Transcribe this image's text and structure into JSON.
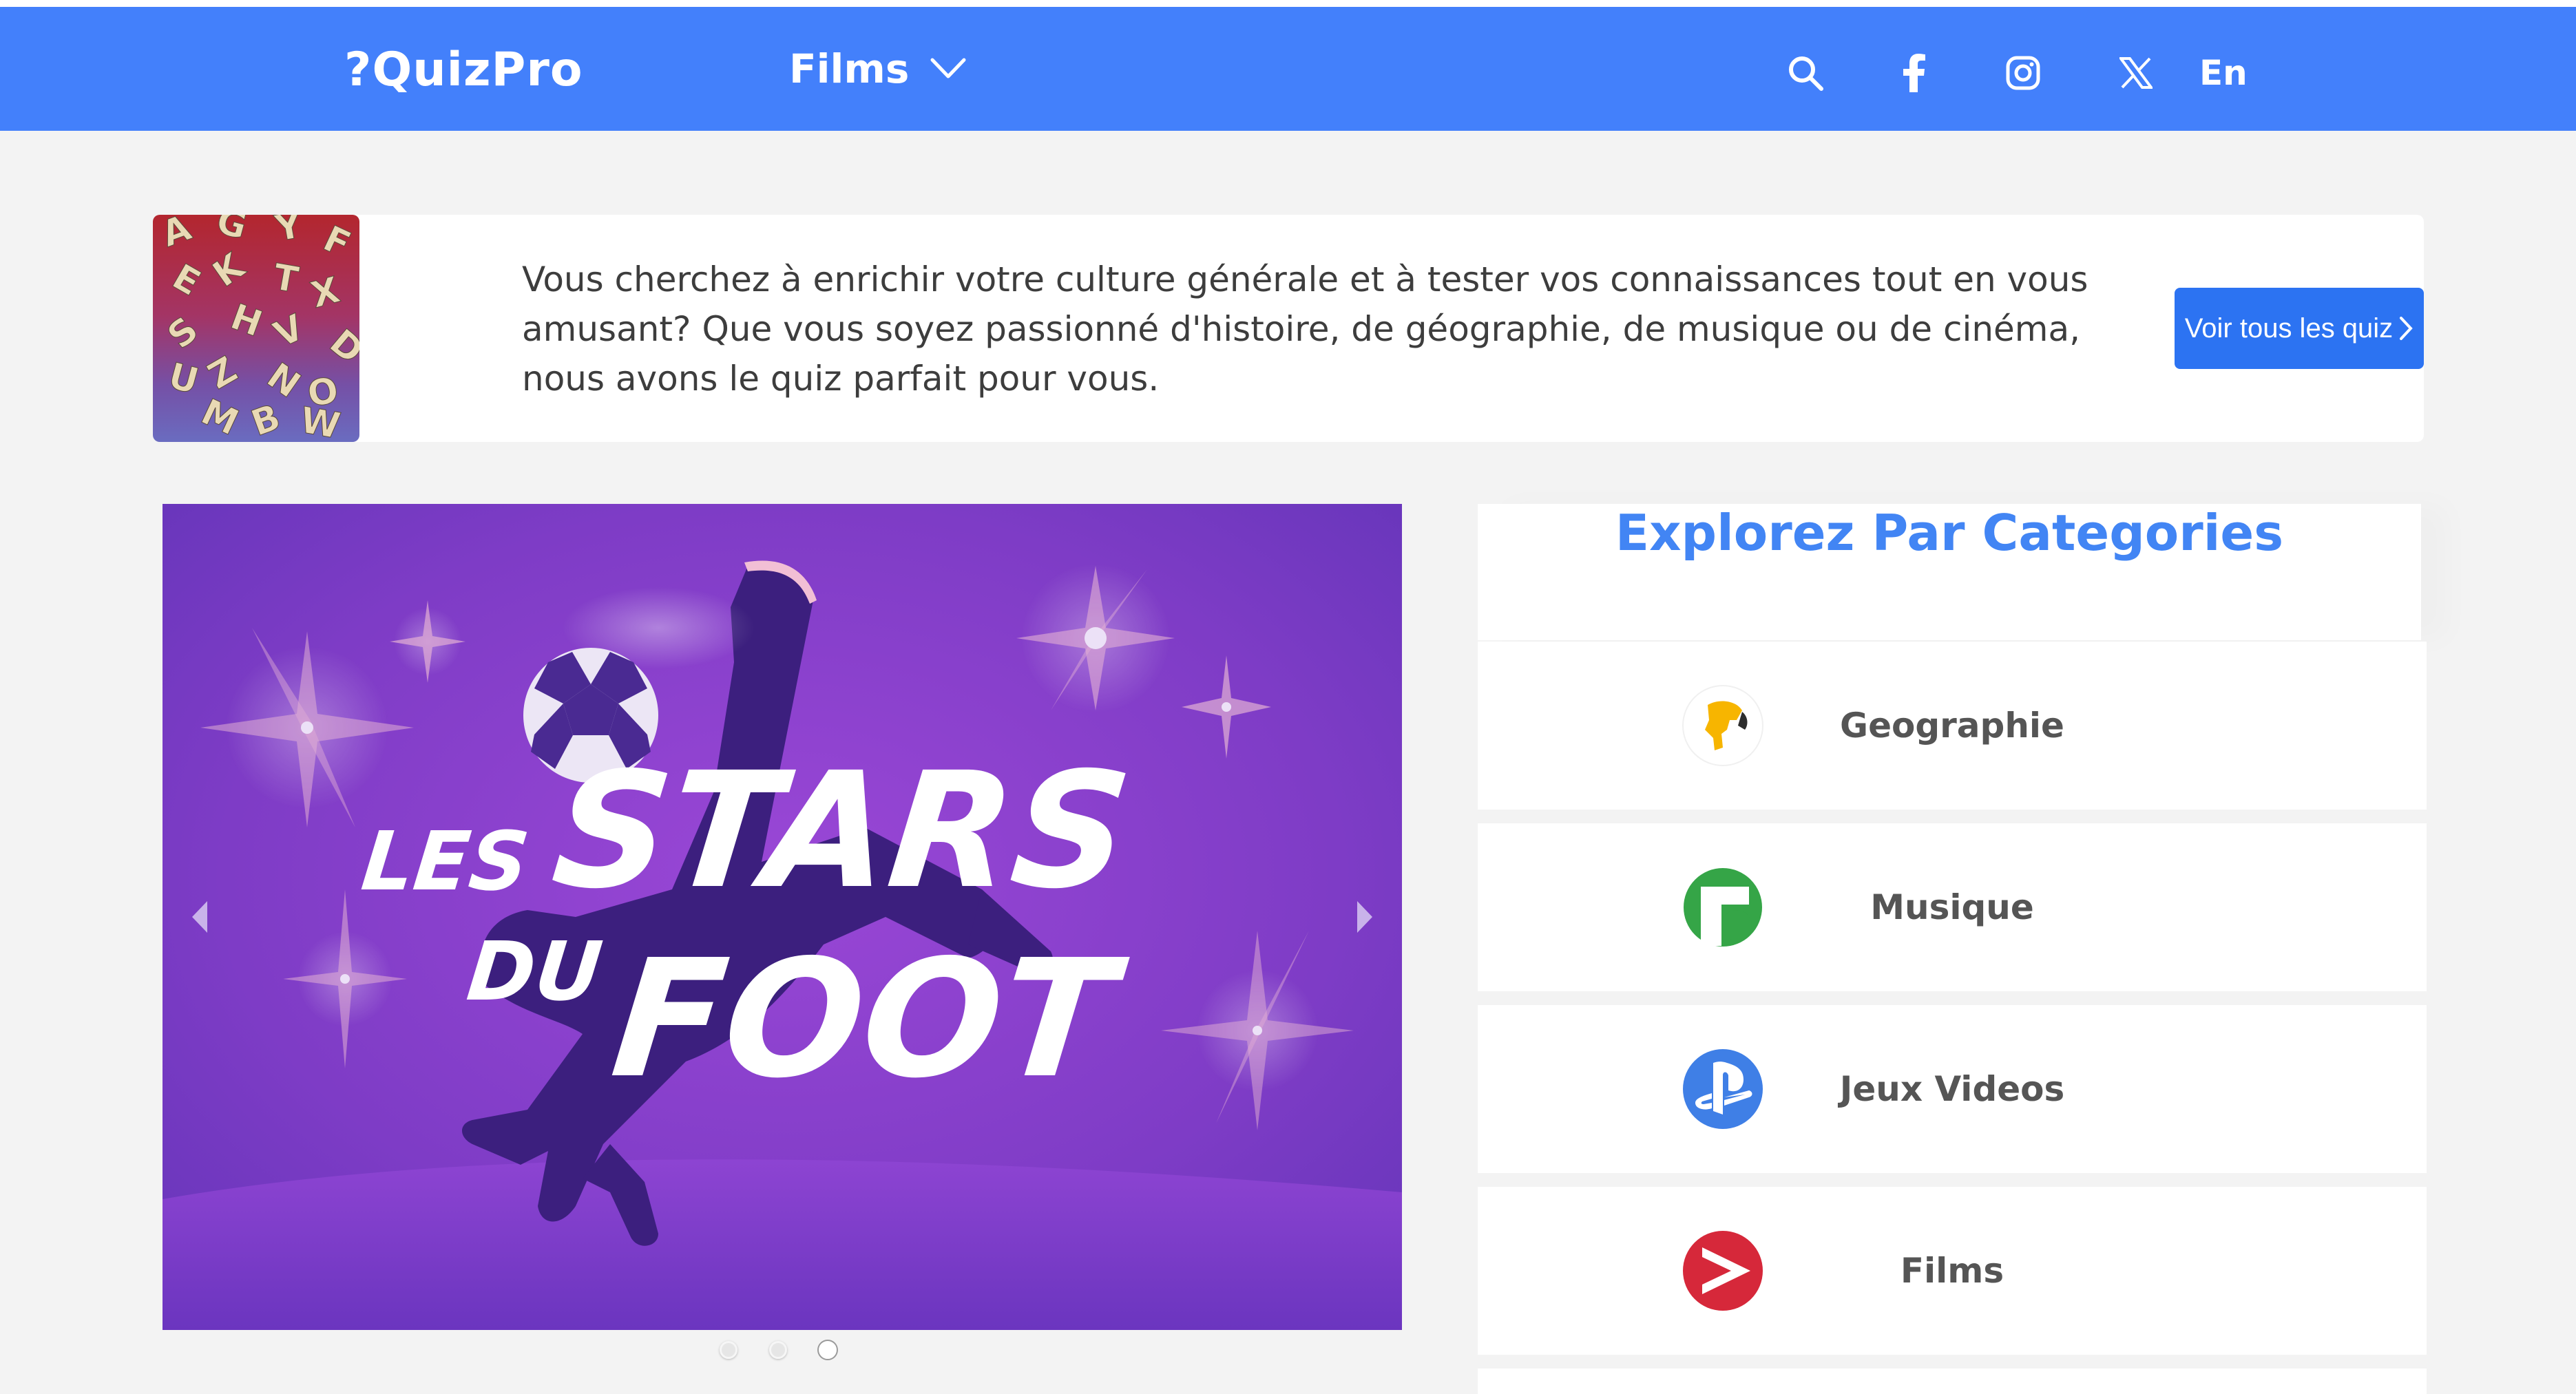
{
  "nav": {
    "logo": "?QuizPro",
    "category_menu": "Films",
    "language": "En",
    "icons": [
      "search-icon",
      "facebook-icon",
      "instagram-icon",
      "x-icon"
    ]
  },
  "intro": {
    "text": "Vous cherchez à enrichir votre culture générale et à tester vos connaissances tout en vous amusant? Que vous soyez passionné d'histoire, de géographie, de musique ou de cinéma, nous avons le quiz parfait pour vous.",
    "button_label": "Voir tous les quiz",
    "image_letters": [
      "A",
      "G",
      "Y",
      "F",
      "E",
      "K",
      "T",
      "X",
      "S",
      "H",
      "V",
      "D",
      "U",
      "Z",
      "N",
      "O",
      "M",
      "B",
      "W"
    ]
  },
  "carousel": {
    "slide_title_line1_small": "LES",
    "slide_title_line1_big": "STARS",
    "slide_title_line2_small": "DU",
    "slide_title_line2_big": "FOOT",
    "total_slides": 3,
    "active_slide": 3
  },
  "categories": {
    "title": "Explorez Par Categories",
    "items": [
      {
        "label": "Geographie",
        "icon": "globe-icon",
        "color": "#f7b500"
      },
      {
        "label": "Musique",
        "icon": "music-icon",
        "color": "#35a547"
      },
      {
        "label": "Jeux Videos",
        "icon": "playstation-icon",
        "color": "#3f7fe6"
      },
      {
        "label": "Films",
        "icon": "play-icon",
        "color": "#d6283a"
      }
    ]
  },
  "colors": {
    "nav_bg": "#4380fb",
    "accent": "#4285f4",
    "button": "#2c73f2",
    "slide_bg": "#8240c8"
  }
}
